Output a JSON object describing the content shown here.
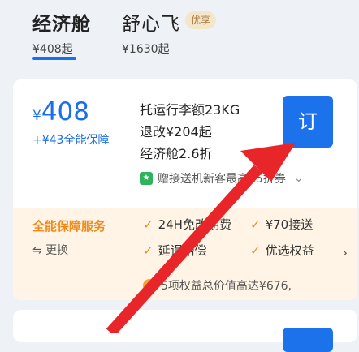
{
  "tabs": [
    {
      "name": "经济舱",
      "price": "¥408起"
    },
    {
      "name": "舒心飞",
      "price": "¥1630起",
      "badge": "优享"
    }
  ],
  "offer": {
    "currency": "¥",
    "price": "408",
    "guarantee": "+¥43全能保障",
    "baggage": "托运行李额23KG",
    "change": "退改¥204起",
    "fare": "经济舱2.6折",
    "book_label": "订",
    "promo_text": "赠接送机新客最高85折券"
  },
  "service": {
    "title": "全能保障服务",
    "swap": "⇋ 更换",
    "features": [
      "24H免改期费",
      "¥70接送",
      "延误赔偿",
      "优选权益"
    ],
    "note": "5项权益总价值高达¥676,"
  },
  "colors": {
    "accent": "#1c72ea",
    "orange": "#f08a1a",
    "arrow": "#e8262a"
  },
  "icons": [
    "check-icon",
    "swap-icon",
    "chevron-right-icon",
    "chevron-down-icon",
    "gift-icon",
    "arrow-annotation-icon"
  ]
}
